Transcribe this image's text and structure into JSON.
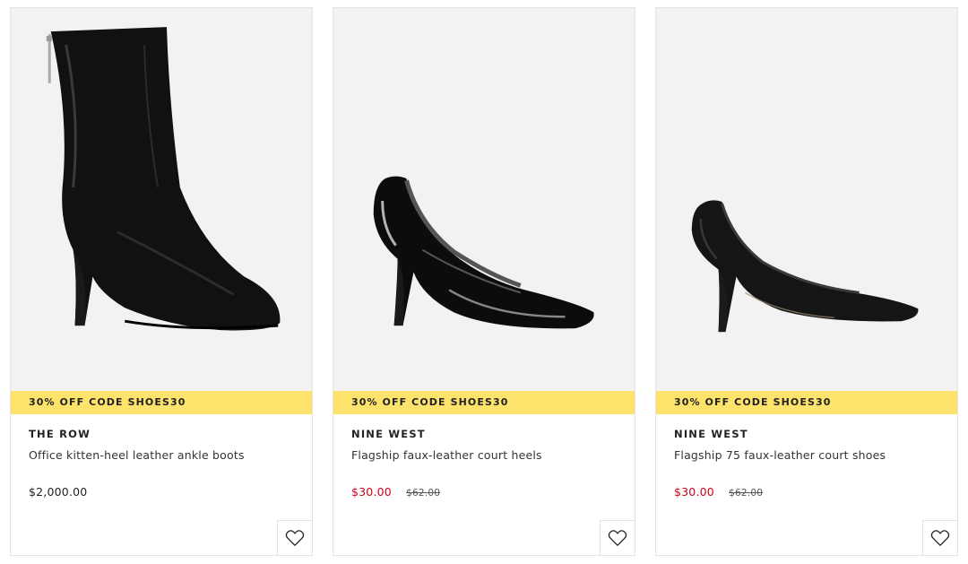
{
  "products": [
    {
      "promo": "30% OFF CODE SHOES30",
      "brand": "THE ROW",
      "name": "Office kitten-heel leather ankle boots",
      "price": "$2,000.00",
      "was_price": "",
      "on_sale": false,
      "image": "black-leather-ankle-boot"
    },
    {
      "promo": "30% OFF CODE SHOES30",
      "brand": "NINE WEST",
      "name": "Flagship faux-leather court heels",
      "price": "$30.00",
      "was_price": "$62.00",
      "on_sale": true,
      "image": "black-patent-pump"
    },
    {
      "promo": "30% OFF CODE SHOES30",
      "brand": "NINE WEST",
      "name": "Flagship 75 faux-leather court shoes",
      "price": "$30.00",
      "was_price": "$62.00",
      "on_sale": true,
      "image": "black-matte-pump"
    }
  ],
  "colors": {
    "promo_bg": "#fde26b",
    "sale_price": "#d0021b",
    "image_bg": "#f2f2f2"
  },
  "icons": {
    "wishlist": "heart-icon"
  }
}
